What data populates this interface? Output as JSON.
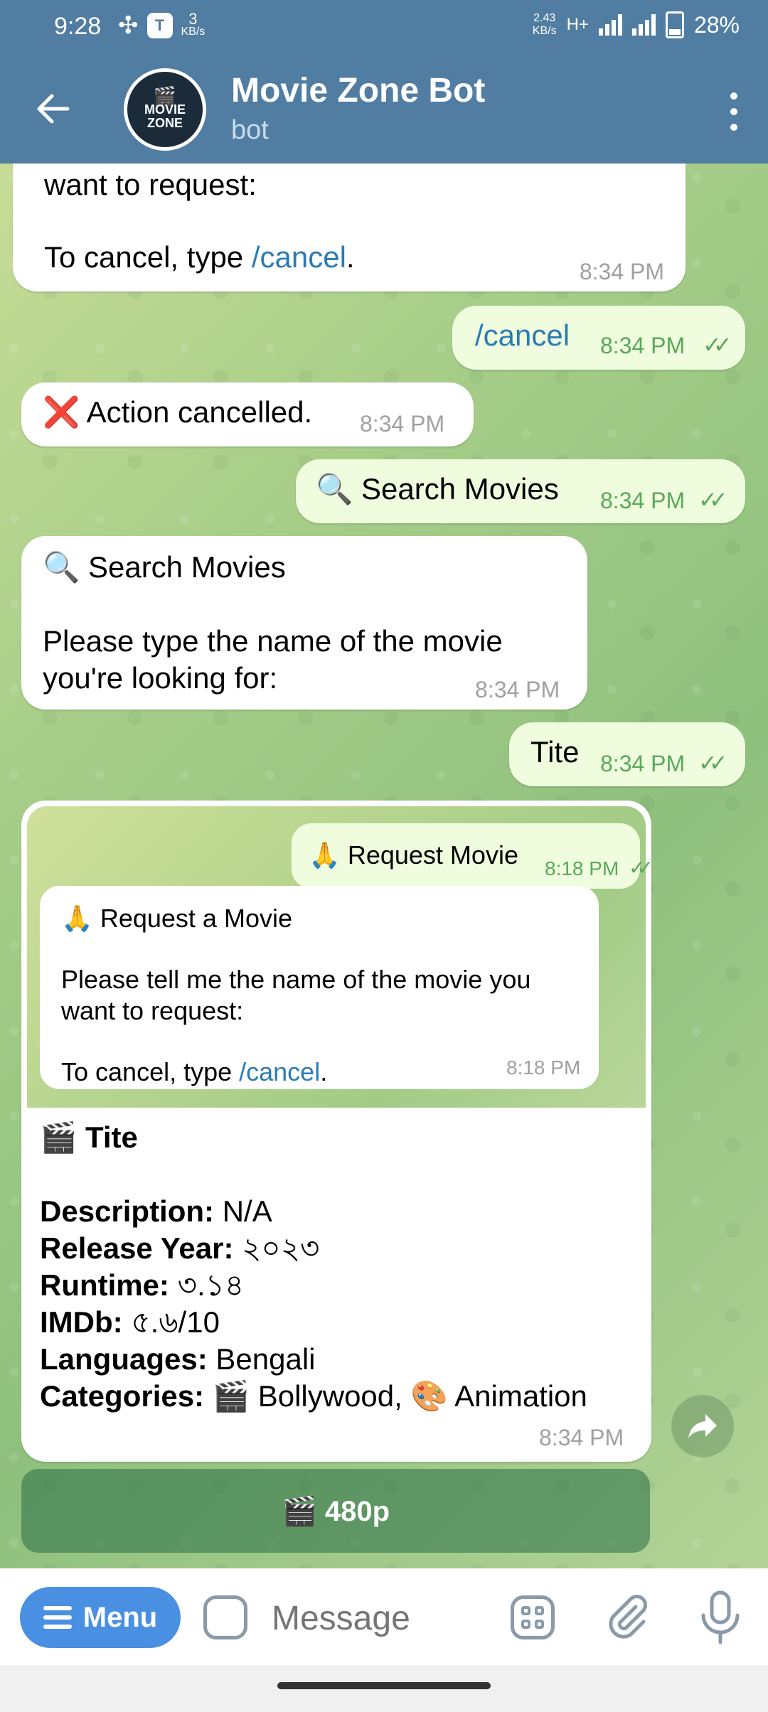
{
  "status": {
    "time": "9:28",
    "net_speed": "3",
    "net_speed_unit": "KB/s",
    "right_speed": "2.43",
    "right_speed_unit": "KB/s",
    "network": "H+",
    "battery": "28%"
  },
  "header": {
    "title": "Movie Zone Bot",
    "subtitle": "bot",
    "avatar_line1": "MOVIE",
    "avatar_line2": "ZONE"
  },
  "messages": [
    {
      "line1": "want to request:",
      "line2_prefix": "To cancel, type ",
      "line2_link": "/cancel",
      "line2_suffix": ".",
      "time": "8:34 PM"
    },
    {
      "text": "/cancel",
      "time": "8:34 PM"
    },
    {
      "emoji": "❌",
      "text": "Action cancelled.",
      "time": "8:34 PM"
    },
    {
      "emoji": "🔍",
      "text": "Search Movies",
      "time": "8:34 PM"
    },
    {
      "title_emoji": "🔍",
      "title": "Search Movies",
      "body_line1": "Please type the name of the movie",
      "body_line2": "you're looking for:",
      "time": "8:34 PM"
    },
    {
      "text": "Tite",
      "time": "8:34 PM"
    }
  ],
  "card": {
    "quoted_out": {
      "emoji": "🙏",
      "text": "Request Movie",
      "time": "8:18 PM"
    },
    "quoted_in": {
      "title_emoji": "🙏",
      "title": "Request a Movie",
      "line1": "Please tell me the name of the movie you",
      "line2": "want to request:",
      "cancel_prefix": "To cancel, type ",
      "cancel_link": "/cancel",
      "cancel_suffix": ".",
      "time": "8:18 PM"
    },
    "title_emoji": "🎬",
    "title": "Tite",
    "description_label": "Description:",
    "description": "N/A",
    "year_label": "Release Year:",
    "year": "২০২৩",
    "runtime_label": "Runtime:",
    "runtime": "৩.১৪",
    "imdb_label": "IMDb:",
    "imdb": "৫.৬/10",
    "languages_label": "Languages:",
    "languages": "Bengali",
    "categories_label": "Categories:",
    "categories": "🎬 Bollywood, 🎨 Animation",
    "time": "8:34 PM"
  },
  "quality_button": "🎬 480p",
  "input": {
    "menu_label": "Menu",
    "placeholder": "Message"
  }
}
